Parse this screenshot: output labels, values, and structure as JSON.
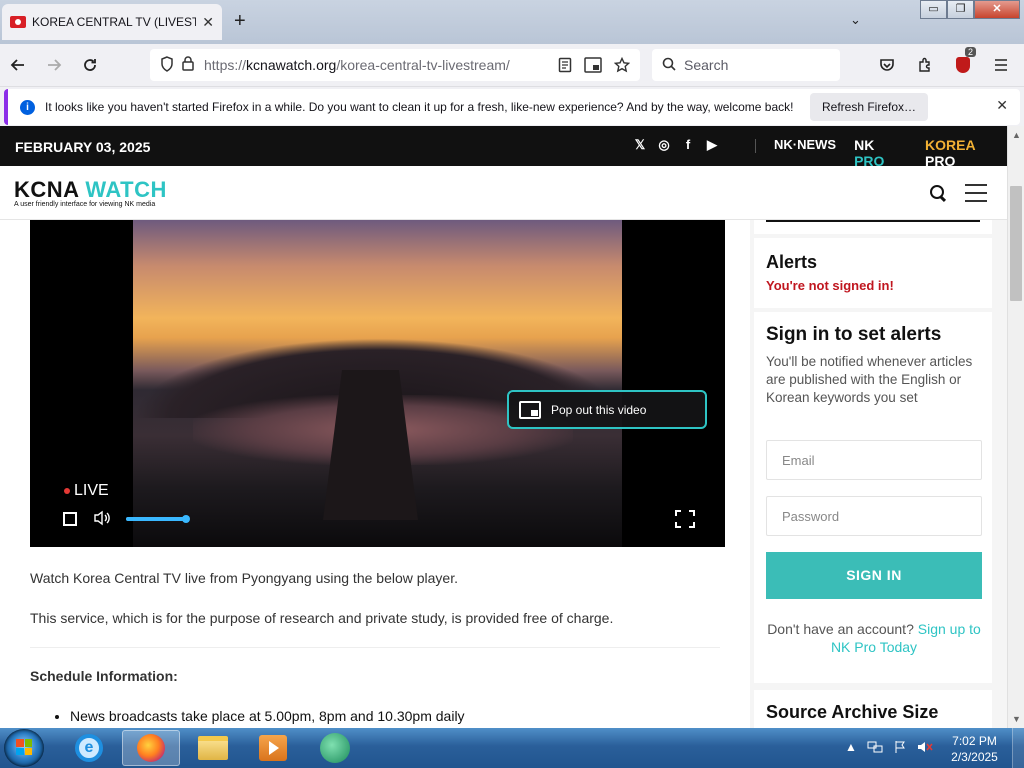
{
  "browser": {
    "tab_title": "KOREA CENTRAL TV (LIVESTREA",
    "tab_close": "✕",
    "new_tab": "+",
    "list_tabs": "⌄",
    "window_controls": {
      "minimize": "▭",
      "restore": "❐",
      "close": "✕"
    },
    "url_proto": "https://",
    "url_host": "kcnawatch.org",
    "url_path": "/korea-central-tv-livestream/",
    "search_placeholder": "Search",
    "extensions_badge_count": "2",
    "notification_text": "It looks like you haven't started Firefox in a while. Do you want to clean it up for a fresh, like-new experience? And by the way, welcome back!",
    "notification_button": "Refresh Firefox…",
    "notification_close": "✕"
  },
  "topbar": {
    "date": "FEBRUARY 03, 2025",
    "social_icons": [
      "x-icon",
      "instagram-icon",
      "facebook-icon",
      "youtube-icon"
    ],
    "social_glyphs": {
      "x": "𝕏",
      "instagram": "◎",
      "facebook": "f",
      "youtube": "▶"
    },
    "nknews": "NK·NEWS",
    "nkpro_prefix": "NK",
    "nkpro_suffix": "PRO",
    "koreapro_prefix": "KOREA",
    "koreapro_suffix": "PRO"
  },
  "header": {
    "logo_prefix": "KCNA",
    "logo_suffix": "WATCH",
    "tagline": "A user friendly interface for viewing NK media"
  },
  "video": {
    "live_label": "LIVE",
    "popout_label": "Pop out this video",
    "volume_level": 1.0
  },
  "content": {
    "intro": "Watch Korea Central TV live from Pyongyang using the below player.",
    "service": "This service, which is for the purpose of research and private study, is provided free of charge.",
    "schedule_heading": "Schedule Information:",
    "schedule_items": [
      "News broadcasts take place at 5.00pm, 8pm and 10.30pm daily"
    ]
  },
  "sidebar": {
    "alerts_title": "Alerts",
    "alerts_status": "You're not signed in!",
    "signin_title": "Sign in to set alerts",
    "signin_desc": "You'll be notified whenever articles are published with the English or Korean keywords you set",
    "email_placeholder": "Email",
    "password_placeholder": "Password",
    "signin_button": "SIGN IN",
    "signup_prefix": "Don't have an account?",
    "signup_link": "Sign up to NK Pro Today",
    "archive_title": "Source Archive Size"
  },
  "taskbar": {
    "time": "7:02 PM",
    "date": "2/3/2025",
    "tray_expand": "▲"
  },
  "colors": {
    "accent_teal": "#2ec4c4",
    "alert_red": "#c0161f",
    "korea_pro_gold": "#f2b134",
    "signin_button": "#3bbdb7"
  }
}
